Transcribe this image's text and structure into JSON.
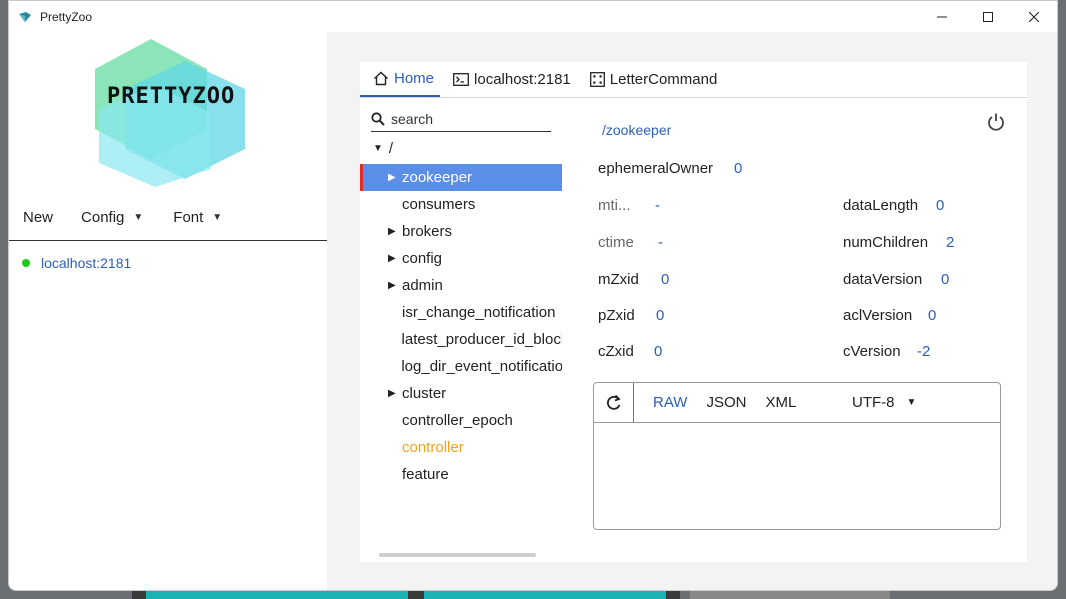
{
  "window": {
    "title": "PrettyZoo"
  },
  "logo": {
    "text": "PRETTYZOO"
  },
  "menu": {
    "new": "New",
    "config": "Config",
    "font": "Font"
  },
  "servers": [
    {
      "label": "localhost:2181",
      "status": "connected",
      "status_color": "#1ec81e"
    }
  ],
  "tabs": [
    {
      "label": "Home",
      "icon": "home-icon",
      "active": true
    },
    {
      "label": "localhost:2181",
      "icon": "terminal-icon"
    },
    {
      "label": "LetterCommand",
      "icon": "command-icon"
    }
  ],
  "search": {
    "placeholder": "search"
  },
  "tree": {
    "root": "/",
    "nodes": [
      {
        "label": "zookeeper",
        "expandable": true,
        "selected": true
      },
      {
        "label": "consumers",
        "expandable": false
      },
      {
        "label": "brokers",
        "expandable": true
      },
      {
        "label": "config",
        "expandable": true
      },
      {
        "label": "admin",
        "expandable": true
      },
      {
        "label": "isr_change_notification",
        "expandable": false
      },
      {
        "label": "latest_producer_id_block",
        "expandable": false
      },
      {
        "label": "log_dir_event_notification",
        "expandable": false
      },
      {
        "label": "cluster",
        "expandable": true
      },
      {
        "label": "controller_epoch",
        "expandable": false
      },
      {
        "label": "controller",
        "expandable": false,
        "highlight": true
      },
      {
        "label": "feature",
        "expandable": false
      }
    ]
  },
  "detail": {
    "path": "/zookeeper",
    "ephemeralOwner": {
      "label": "ephemeralOwner",
      "value": "0"
    },
    "mtime": {
      "label": "mti...",
      "value": "-"
    },
    "ctime": {
      "label": "ctime",
      "value": "-"
    },
    "mZxid": {
      "label": "mZxid",
      "value": "0"
    },
    "pZxid": {
      "label": "pZxid",
      "value": "0"
    },
    "cZxid": {
      "label": "cZxid",
      "value": "0"
    },
    "dataLength": {
      "label": "dataLength",
      "value": "0"
    },
    "numChildren": {
      "label": "numChildren",
      "value": "2"
    },
    "dataVersion": {
      "label": "dataVersion",
      "value": "0"
    },
    "aclVersion": {
      "label": "aclVersion",
      "value": "0"
    },
    "cVersion": {
      "label": "cVersion",
      "value": "-2"
    }
  },
  "editor": {
    "formats": [
      "RAW",
      "JSON",
      "XML"
    ],
    "active_format": "RAW",
    "charset": "UTF-8",
    "content": ""
  },
  "colors": {
    "accent": "#2b5fb8",
    "selection": "#5b8ee6",
    "selection_marker": "#e12c2c",
    "highlight_node": "#f0a31d"
  }
}
